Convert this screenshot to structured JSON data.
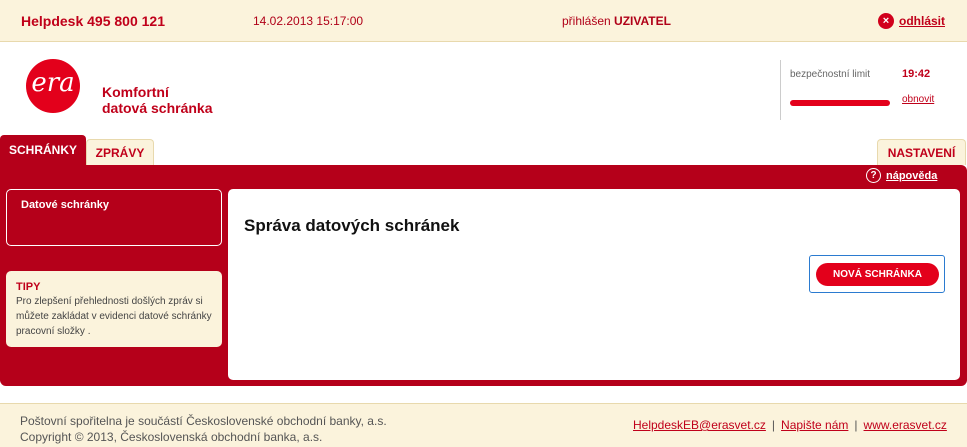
{
  "topbar": {
    "helpdesk": "Helpdesk 495 800 121",
    "datetime": "14.02.2013 15:17:00",
    "logged_prefix": "přihlášen",
    "logged_user": "UZIVATEL",
    "logout_label": "odhlásit",
    "logout_icon": "×"
  },
  "brand": {
    "logo_text": "era",
    "line1": "Komfortní",
    "line2": "datová schránka"
  },
  "security": {
    "label": "bezpečnostní limit",
    "time": "19:42",
    "refresh_label": "obnovit",
    "level": 1.0
  },
  "tabs": [
    {
      "label": "SCHRÁNKY",
      "active": true
    },
    {
      "label": "ZPRÁVY",
      "active": false
    },
    {
      "label": "NASTAVENÍ",
      "active": false
    }
  ],
  "help": {
    "icon": "?",
    "label": "nápověda"
  },
  "sidebar": {
    "boxes_label": "Datové schránky",
    "tips_title": "TIPY",
    "tips_body": "Pro zlepšení přehlednosti došlých zpráv si můžete zakládat v evidenci datové schránky pracovní složky ."
  },
  "main": {
    "title": "Správa datových schránek",
    "new_box_button": "NOVÁ SCHRÁNKA"
  },
  "footer": {
    "line1": "Poštovní spořitelna je součástí Československé obchodní banky, a.s.",
    "line2": "Copyright © 2013, Československá obchodní banka, a.s.",
    "links": [
      "HelpdeskEB@erasvet.cz",
      "Napište nám",
      "www.erasvet.cz"
    ]
  },
  "colors": {
    "accent": "#e3001b",
    "panel": "#b5001a",
    "cream": "#fbf3dc"
  }
}
